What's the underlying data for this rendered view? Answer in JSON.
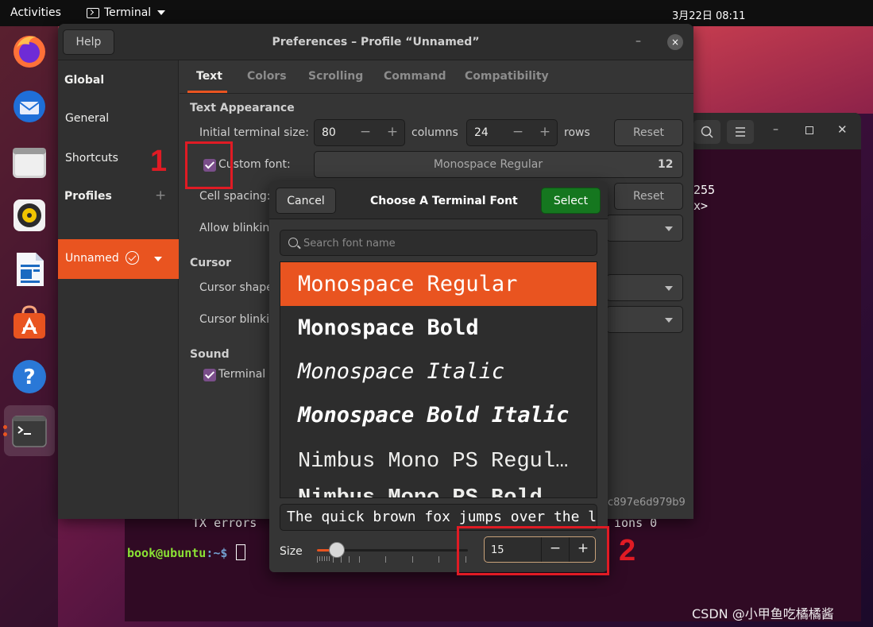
{
  "topbar": {
    "activities": "Activities",
    "app_name": "Terminal",
    "clock": "3月22日  08:11"
  },
  "dock": {
    "items": [
      "firefox-icon",
      "thunderbird-icon",
      "files-icon",
      "rhythmbox-icon",
      "libreoffice-writer-icon",
      "ubuntu-software-icon",
      "help-icon",
      "terminal-icon"
    ]
  },
  "background_terminal": {
    "partial_line_1": "255",
    "partial_line_2": "x>",
    "line_tx": "TX errors",
    "line_tx_tail": "ions 0",
    "prompt_user": "book@ubuntu",
    "prompt_sep": ":~$"
  },
  "preferences": {
    "help": "Help",
    "title": "Preferences – Profile “Unnamed”",
    "minimize": "–",
    "close": "×",
    "sidebar": {
      "global": "Global",
      "general": "General",
      "shortcuts": "Shortcuts",
      "profiles": "Profiles",
      "add": "+",
      "profile_name": "Unnamed"
    },
    "tabs": [
      "Text",
      "Colors",
      "Scrolling",
      "Command",
      "Compatibility"
    ],
    "text_appearance": "Text Appearance",
    "initial_size_label": "Initial terminal size:",
    "columns_value": "80",
    "columns_label": "columns",
    "rows_value": "24",
    "rows_label": "rows",
    "reset": "Reset",
    "custom_font_label": "Custom font:",
    "font_name": "Monospace Regular",
    "font_size": "12",
    "cell_spacing_label": "Cell spacing:",
    "allow_blinking_label": "Allow blinking",
    "cursor_section": "Cursor",
    "cursor_shape_label": "Cursor shape",
    "cursor_blinking_label": "Cursor blinkin",
    "sound_section": "Sound",
    "terminal_bell_label": "Terminal b",
    "profile_id_fragment": "c897e6d979b9"
  },
  "font_chooser": {
    "cancel": "Cancel",
    "title": "Choose A Terminal Font",
    "select": "Select",
    "search_placeholder": "Search font name",
    "fonts": [
      "Monospace Regular",
      "Monospace Bold",
      "Monospace Italic",
      "Monospace Bold Italic",
      "Nimbus Mono PS Regular",
      "Nimbus Mono PS Bold"
    ],
    "selected_index": 0,
    "preview_text": "The quick brown fox jumps over the lazy dog",
    "size_label": "Size",
    "size_value": "15",
    "minus": "−",
    "plus": "+"
  },
  "annotations": {
    "one": "1",
    "two": "2"
  },
  "watermark": "CSDN @小甲鱼吃橘橘酱",
  "colors": {
    "accent": "#e95420",
    "select_green": "#15771f",
    "annotation_red": "#e01b24"
  }
}
